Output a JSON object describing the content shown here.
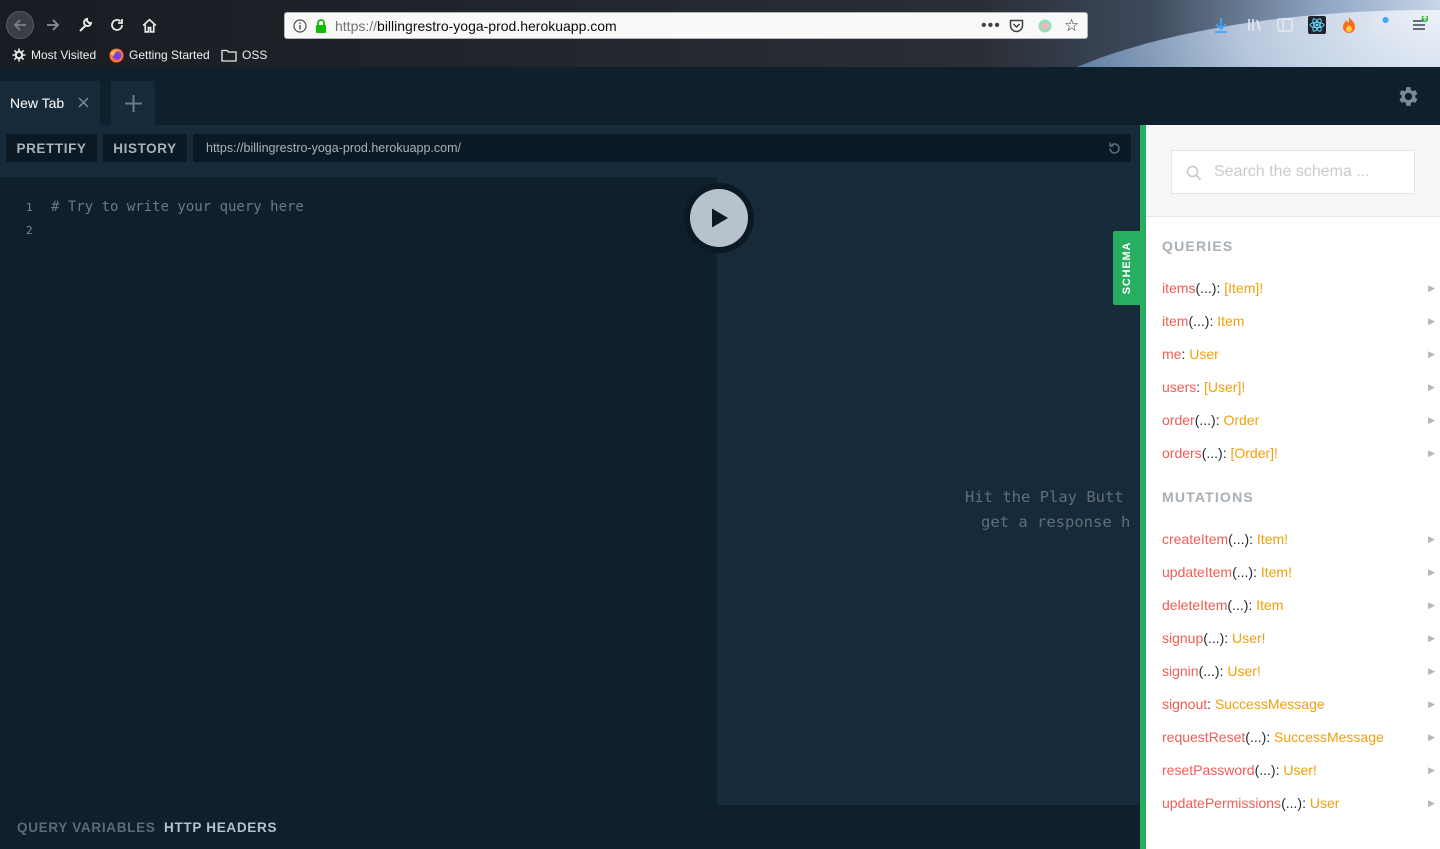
{
  "browser": {
    "url_scheme": "https://",
    "url_host": "billingrestro-yoga-prod.herokuapp.com",
    "bookmarks": [
      {
        "label": "Most Visited"
      },
      {
        "label": "Getting Started"
      },
      {
        "label": "OSS"
      }
    ]
  },
  "playground": {
    "tab_title": "New Tab",
    "prettify_label": "PRETTIFY",
    "history_label": "HISTORY",
    "endpoint_url": "https://billingrestro-yoga-prod.herokuapp.com/",
    "editor": {
      "line_numbers": [
        "1",
        "2"
      ],
      "placeholder_comment": "# Try to write your query here"
    },
    "result_placeholder": [
      "Hit the Play Butt",
      "get a response h"
    ],
    "bottom_tabs": {
      "query_variables": "QUERY VARIABLES",
      "http_headers": "HTTP HEADERS"
    },
    "schema_tab_label": "SCHEMA"
  },
  "schema": {
    "search_placeholder": "Search the schema ...",
    "queries_title": "QUERIES",
    "queries": [
      {
        "name": "items",
        "args": "(...)",
        "type": "[Item]!"
      },
      {
        "name": "item",
        "args": "(...)",
        "type": "Item"
      },
      {
        "name": "me",
        "args": "",
        "type": "User"
      },
      {
        "name": "users",
        "args": "",
        "type": "[User]!"
      },
      {
        "name": "order",
        "args": "(...)",
        "type": "Order"
      },
      {
        "name": "orders",
        "args": "(...)",
        "type": "[Order]!"
      }
    ],
    "mutations_title": "MUTATIONS",
    "mutations": [
      {
        "name": "createItem",
        "args": "(...)",
        "type": "Item!"
      },
      {
        "name": "updateItem",
        "args": "(...)",
        "type": "Item!"
      },
      {
        "name": "deleteItem",
        "args": "(...)",
        "type": "Item"
      },
      {
        "name": "signup",
        "args": "(...)",
        "type": "User!"
      },
      {
        "name": "signin",
        "args": "(...)",
        "type": "User!"
      },
      {
        "name": "signout",
        "args": "",
        "type": "SuccessMessage"
      },
      {
        "name": "requestReset",
        "args": "(...)",
        "type": "SuccessMessage"
      },
      {
        "name": "resetPassword",
        "args": "(...)",
        "type": "User!"
      },
      {
        "name": "updatePermissions",
        "args": "(...)",
        "type": "User"
      }
    ]
  },
  "colors": {
    "accent_green": "#27ae60",
    "field_name": "#f25c54",
    "field_type": "#f1a00b",
    "background": "#0f202d"
  }
}
